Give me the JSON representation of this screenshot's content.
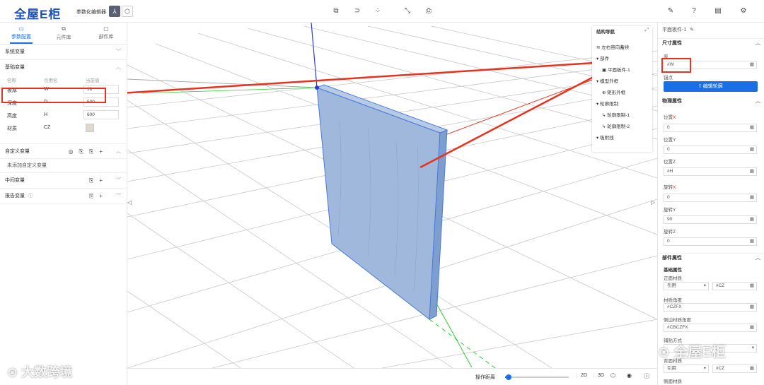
{
  "header": {
    "logo": "全屋E柜",
    "mode_label": "参数化编辑器"
  },
  "left_panel": {
    "tabs": [
      {
        "label": "参数配置",
        "icon": "document-icon"
      },
      {
        "label": "元件库",
        "icon": "component-icon"
      },
      {
        "label": "部件库",
        "icon": "folder-icon"
      }
    ],
    "sections": {
      "system": "系统变量",
      "basic": "基础变量",
      "custom": "自定义变量",
      "custom_empty": "未添加自定义变量",
      "intermediate": "中间变量",
      "report": "报告变量"
    },
    "columns": {
      "name": "名称",
      "ref": "引用名",
      "current": "当前值"
    },
    "variables": [
      {
        "name": "板厚",
        "ref": "W",
        "value": "18"
      },
      {
        "name": "深度",
        "ref": "D",
        "value": "500"
      },
      {
        "name": "高度",
        "ref": "H",
        "value": "600"
      },
      {
        "name": "材质",
        "ref": "CZ",
        "value": ""
      }
    ]
  },
  "structure_nav": {
    "title": "结构导航",
    "items": [
      "左右容向蓄续",
      "部件",
      "平面板件-1",
      "模型外框",
      "矩形外框",
      "轮廓限制",
      "轮廓限制-1",
      "轮廓限制-2",
      "吸附线"
    ]
  },
  "bottom_bar": {
    "distance_label": "操作距离",
    "view_2d": "2D",
    "view_3d": "3D",
    "slider_value": 0.05
  },
  "right_panel": {
    "title": "平面板件-1",
    "size_section": "尺寸属性",
    "thickness_label": "厚",
    "thickness_value": "#W",
    "anchor_label": "锚点",
    "edit_button": "编辑轮廓",
    "physical_section": "物理属性",
    "position_x_label": "位置",
    "position_x_axis": "X",
    "position_x_value": "0",
    "position_y_label": "位置Y",
    "position_y_value": "0",
    "position_z_label": "位置Z",
    "position_z_value": "#H",
    "rotate_x_label": "旋转",
    "rotate_x_axis": "X",
    "rotate_x_value": "0",
    "rotate_y_label": "旋转Y",
    "rotate_y_value": "90",
    "rotate_z_label": "旋转Z",
    "rotate_z_value": "0",
    "part_section": "部件属性",
    "basic_attr": "基础属性",
    "front_material_label": "正面材质",
    "front_material_mode": "引用",
    "front_material_value": "#CZ",
    "texture_angle_label": "材质角度",
    "texture_angle_value": "#CZFX",
    "side_angle_label": "侧边材质角度",
    "side_angle_value": "#CBCZFX",
    "edge_label": "铺贴方式",
    "back_material_label": "背面材质",
    "back_material_mode": "引用",
    "back_material_value": "#CZ",
    "side_material_label": "侧面材质"
  },
  "watermarks": {
    "left": "大数跨境",
    "right": "全屋E柜"
  },
  "colors": {
    "accent": "#1a6ee6",
    "highlight": "#e8321e",
    "panel_board": "#9fb8dc",
    "logo": "#1a4fb8"
  }
}
